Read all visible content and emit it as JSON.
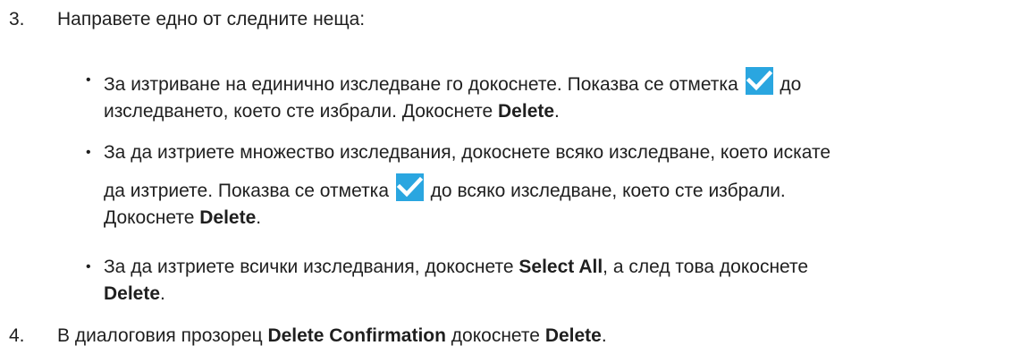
{
  "step3": {
    "number": "3.",
    "text": "Направете едно от следните неща:"
  },
  "bullet1": {
    "dot": "•",
    "line1_before": "За изтриване на единично изследване го докоснете. Показва се отметка ",
    "line1_after": " до",
    "line2_before": "изследването, което сте избрали. Докоснете ",
    "line2_bold": "Delete",
    "line2_after": "."
  },
  "bullet2": {
    "dot": "•",
    "line1": "За да изтриете множество изследвания, докоснете всяко изследване, което искате",
    "line2_before": "да изтриете. Показва се отметка ",
    "line2_after": " до всяко изследване, което сте избрали.",
    "line3_before": "Докоснете ",
    "line3_bold": "Delete",
    "line3_after": "."
  },
  "bullet3": {
    "dot": "•",
    "line1_before": "За да изтриете всички изследвания, докоснете ",
    "line1_bold": "Select All",
    "line1_after": ", а след това докоснете",
    "line2_bold": "Delete",
    "line2_after": "."
  },
  "step4": {
    "number": "4.",
    "before": "В диалоговия прозорец ",
    "bold1": "Delete Confirmation",
    "middle": " докоснете ",
    "bold2": "Delete",
    "after": "."
  },
  "icons": {
    "checkmark": "checkmark-icon",
    "checkmark_bg": "#2aa6e0",
    "checkmark_fg": "#ffffff"
  }
}
